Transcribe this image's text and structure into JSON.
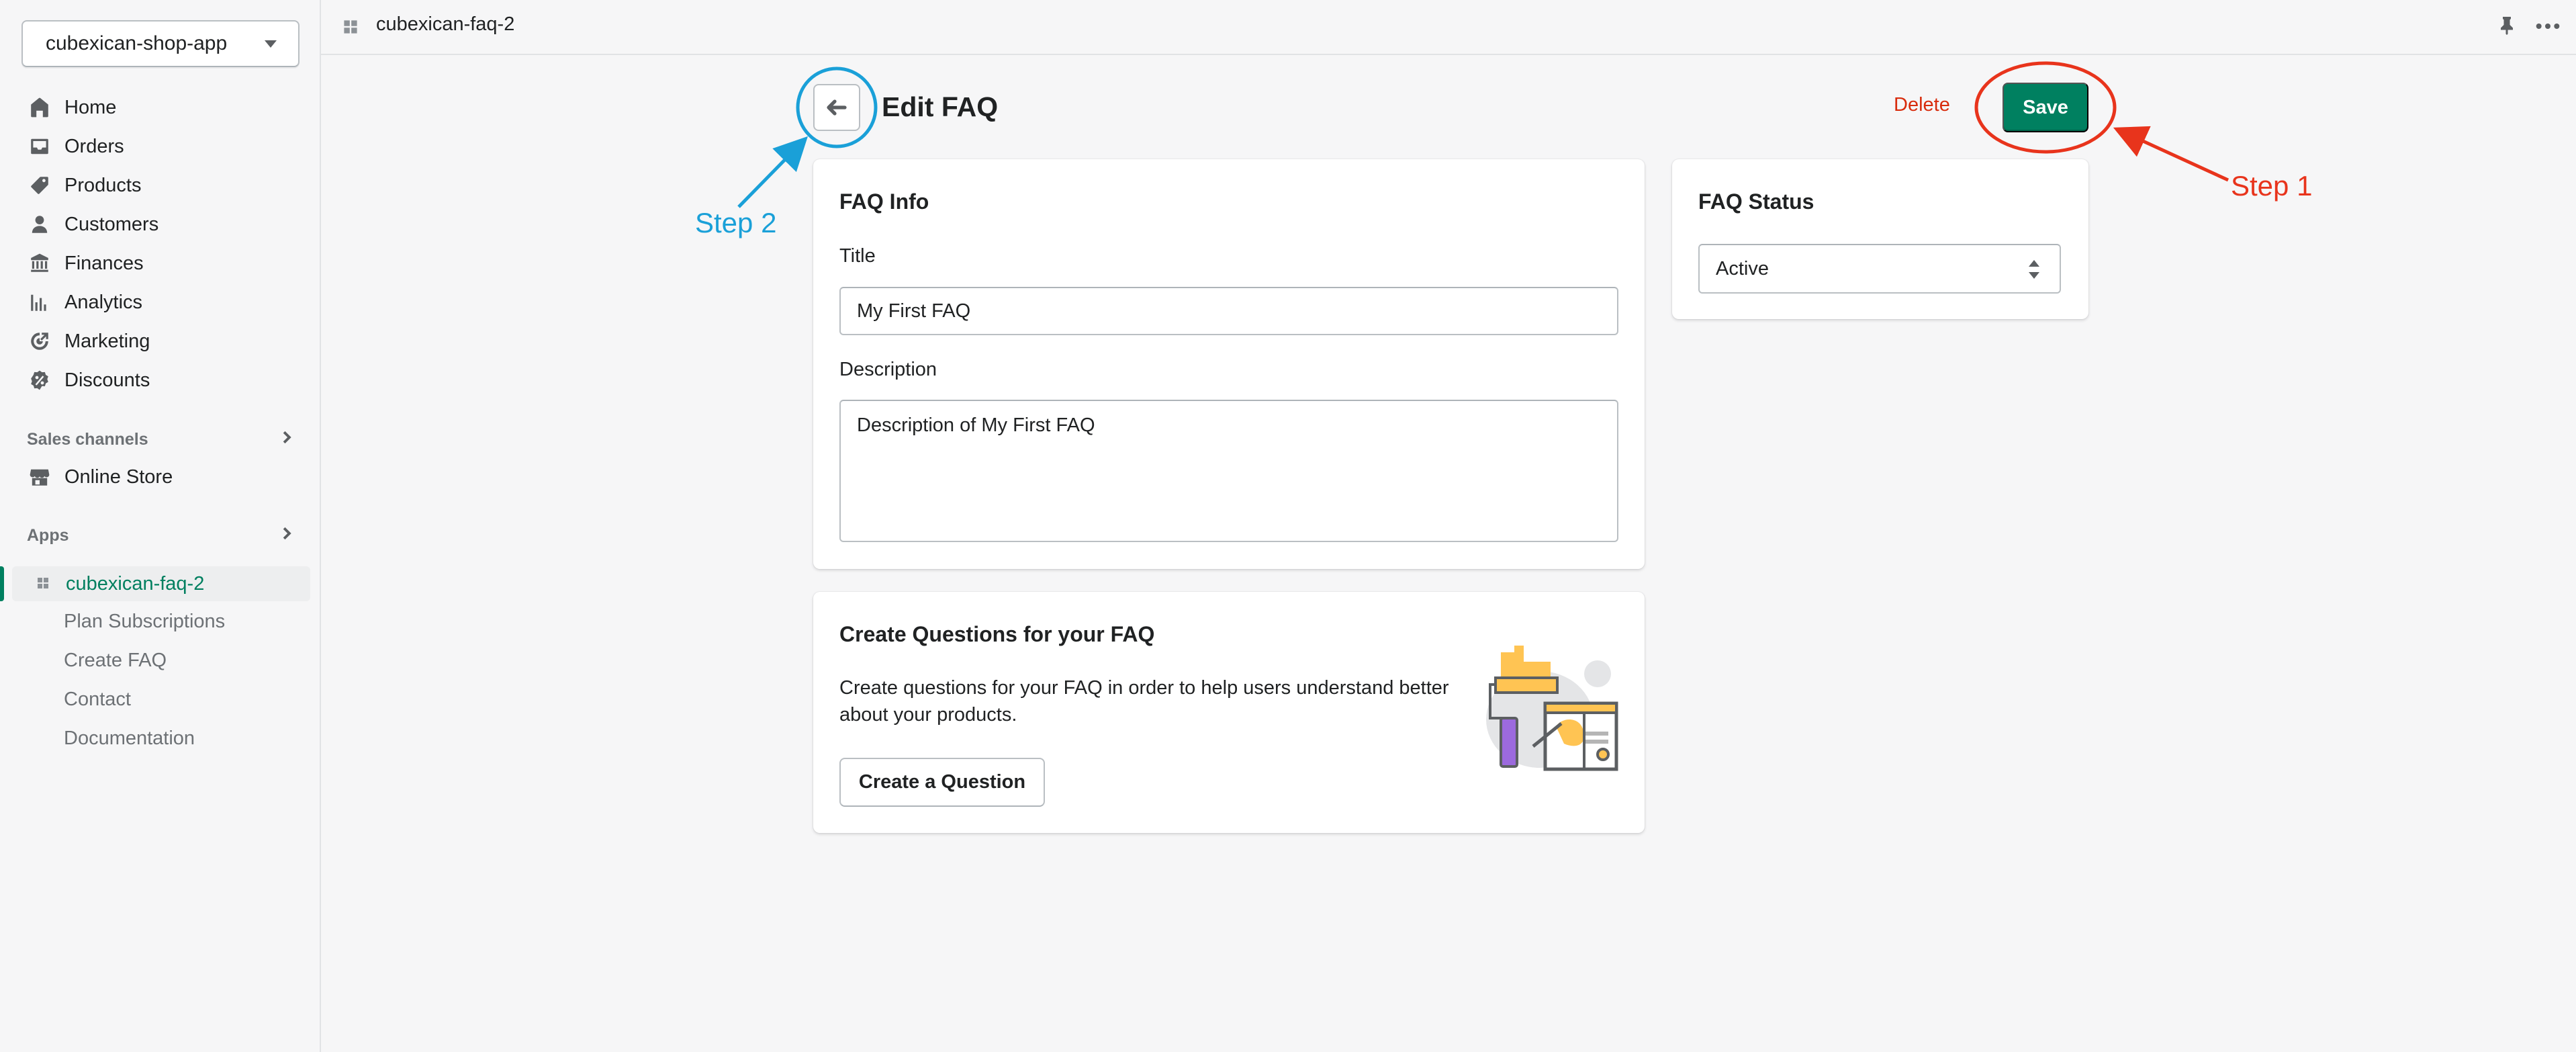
{
  "sidebar": {
    "store_name": "cubexican-shop-app",
    "nav": [
      {
        "label": "Home",
        "icon": "home-icon"
      },
      {
        "label": "Orders",
        "icon": "orders-icon"
      },
      {
        "label": "Products",
        "icon": "tag-icon"
      },
      {
        "label": "Customers",
        "icon": "person-icon"
      },
      {
        "label": "Finances",
        "icon": "bank-icon"
      },
      {
        "label": "Analytics",
        "icon": "bar-chart-icon"
      },
      {
        "label": "Marketing",
        "icon": "marketing-icon"
      },
      {
        "label": "Discounts",
        "icon": "discount-icon"
      }
    ],
    "sales_channels_title": "Sales channels",
    "online_store_label": "Online Store",
    "apps_title": "Apps",
    "apps": [
      {
        "label": "cubexican-faq-2",
        "active": true
      },
      {
        "label": "Plan Subscriptions"
      },
      {
        "label": "Create FAQ"
      },
      {
        "label": "Contact"
      },
      {
        "label": "Documentation"
      }
    ]
  },
  "topbar": {
    "breadcrumb": "cubexican-faq-2"
  },
  "page": {
    "title": "Edit FAQ",
    "delete_label": "Delete",
    "save_label": "Save"
  },
  "faq_info": {
    "title": "FAQ Info",
    "title_label": "Title",
    "title_value": "My First FAQ",
    "description_label": "Description",
    "description_value": "Description of My First FAQ"
  },
  "faq_status": {
    "title": "FAQ Status",
    "selected": "Active"
  },
  "create_questions": {
    "title": "Create Questions for your FAQ",
    "body": "Create questions for your FAQ in order to help users understand better about your products.",
    "button_label": "Create a Question"
  },
  "annotations": {
    "step1": "Step 1",
    "step2": "Step 2"
  },
  "colors": {
    "primary": "#008060",
    "critical": "#d82c0d",
    "annotation_red": "#e8341c",
    "annotation_blue": "#1aa0d8",
    "active_text": "#007f5f"
  }
}
